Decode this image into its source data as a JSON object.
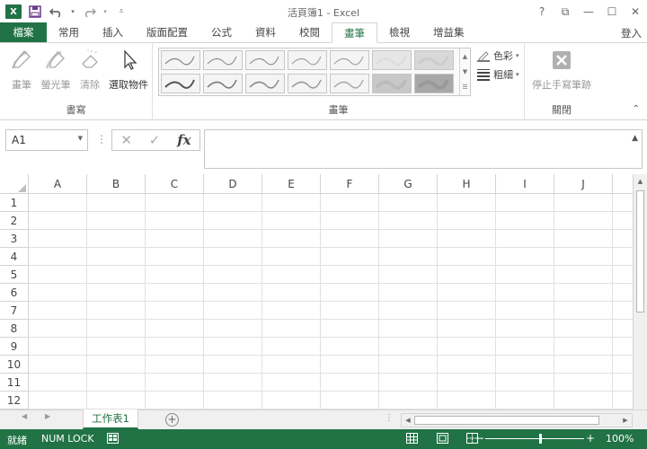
{
  "app": {
    "title": "活頁簿1 - Excel",
    "logo": "X",
    "login_label": "登入"
  },
  "window_controls": [
    "?",
    "⧉",
    "—",
    "☐",
    "✕"
  ],
  "tabs": [
    {
      "label": "檔案",
      "kind": "file"
    },
    {
      "label": "常用"
    },
    {
      "label": "插入"
    },
    {
      "label": "版面配置"
    },
    {
      "label": "公式"
    },
    {
      "label": "資料"
    },
    {
      "label": "校閱"
    },
    {
      "label": "畫筆",
      "active": true
    },
    {
      "label": "檢視"
    },
    {
      "label": "增益集"
    }
  ],
  "ribbon": {
    "write_group": {
      "label": "書寫",
      "pen_label": "畫筆",
      "highlighter_label": "螢光筆",
      "eraser_label": "清除",
      "select_label": "選取物件"
    },
    "pens_group": {
      "label": "畫筆",
      "color_label": "色彩",
      "weight_label": "粗細"
    },
    "close_group": {
      "label": "關閉",
      "stop_label": "停止手寫筆跡"
    }
  },
  "formula_bar": {
    "name_box": "A1",
    "fx_label": "fx",
    "formula": ""
  },
  "grid": {
    "columns": [
      "A",
      "B",
      "C",
      "D",
      "E",
      "F",
      "G",
      "H",
      "I",
      "J"
    ],
    "rows": [
      "1",
      "2",
      "3",
      "4",
      "5",
      "6",
      "7",
      "8",
      "9",
      "10",
      "11",
      "12"
    ]
  },
  "sheets": [
    {
      "label": "工作表1",
      "active": true
    }
  ],
  "status": {
    "ready": "就緒",
    "num_lock": "NUM LOCK",
    "zoom": "100%"
  },
  "colors": {
    "accent": "#217346"
  }
}
